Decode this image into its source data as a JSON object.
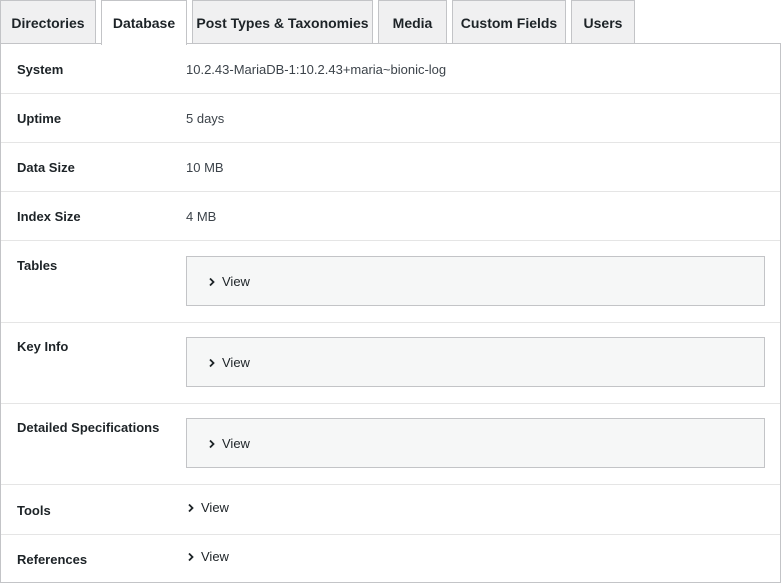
{
  "tabs": [
    {
      "label": "Directories",
      "active": false
    },
    {
      "label": "Database",
      "active": true
    },
    {
      "label": "Post Types & Taxonomies",
      "active": false
    },
    {
      "label": "Media",
      "active": false
    },
    {
      "label": "Custom Fields",
      "active": false
    },
    {
      "label": "Users",
      "active": false
    }
  ],
  "rows": {
    "system": {
      "label": "System",
      "value": "10.2.43-MariaDB-1:10.2.43+maria~bionic-log"
    },
    "uptime": {
      "label": "Uptime",
      "value": "5 days"
    },
    "data_size": {
      "label": "Data Size",
      "value": "10 MB"
    },
    "index_size": {
      "label": "Index Size",
      "value": "4 MB"
    },
    "tables": {
      "label": "Tables",
      "toggle": "View"
    },
    "key_info": {
      "label": "Key Info",
      "toggle": "View"
    },
    "detailed_specs": {
      "label": "Detailed Specifications",
      "toggle": "View"
    },
    "tools": {
      "label": "Tools",
      "toggle": "View"
    },
    "references": {
      "label": "References",
      "toggle": "View"
    }
  },
  "icons": {
    "toggle": "chevron-right-icon"
  },
  "colors": {
    "border": "#c3c4c7",
    "tab_bg": "#f0f0f1",
    "box_bg": "#f6f7f7",
    "text": "#1d2327"
  }
}
